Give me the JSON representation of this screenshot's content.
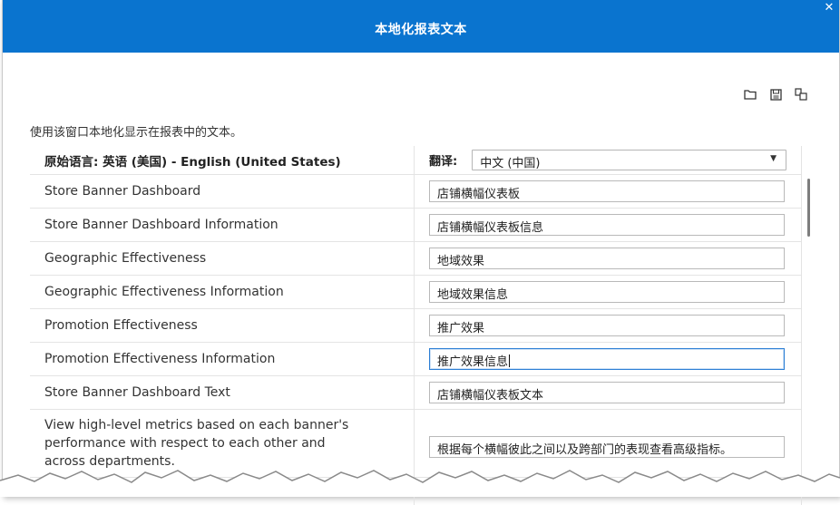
{
  "dialog": {
    "title": "本地化报表文本",
    "close_icon": "close-icon"
  },
  "toolbar": {
    "icons": [
      "folder-icon",
      "save-icon",
      "copy-icon"
    ]
  },
  "instruction": "使用该窗口本地化显示在报表中的文本。",
  "header": {
    "original_language": "原始语言: 英语 (美国) - English (United States)",
    "translation_label": "翻译:",
    "translation_selected": "中文 (中国)"
  },
  "rows": [
    {
      "original": "Store Banner Dashboard",
      "translation": "店铺横幅仪表板"
    },
    {
      "original": "Store Banner Dashboard Information",
      "translation": "店铺横幅仪表板信息"
    },
    {
      "original": "Geographic Effectiveness",
      "translation": "地域效果"
    },
    {
      "original": "Geographic Effectiveness Information",
      "translation": "地域效果信息"
    },
    {
      "original": "Promotion Effectiveness",
      "translation": "推广效果"
    },
    {
      "original": "Promotion Effectiveness Information",
      "translation": "推广效果信息"
    },
    {
      "original": "Store Banner Dashboard Text",
      "translation": "店铺横幅仪表板文本"
    },
    {
      "original": "View high-level metrics based on each banner's performance with respect to each other and across departments.",
      "translation": "根据每个横幅彼此之间以及跨部门的表现查看高级指标。"
    }
  ],
  "colors": {
    "titlebar": "#0a74cf",
    "focus_border": "#2d7fd5"
  }
}
